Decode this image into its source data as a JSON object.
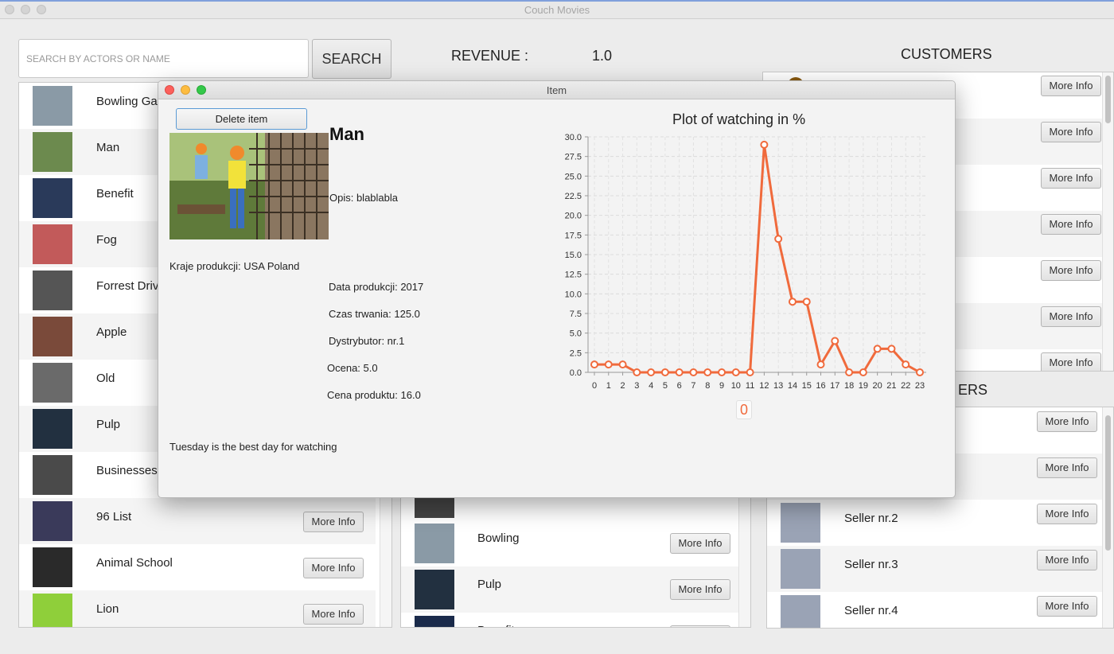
{
  "window": {
    "title": "Couch Movies"
  },
  "search": {
    "placeholder": "SEARCH BY ACTORS OR NAME",
    "button_label": "SEARCH"
  },
  "revenue": {
    "label": "REVENUE :",
    "value": "1.0"
  },
  "customers": {
    "title": "CUSTOMERS",
    "button_label": "More Info",
    "count_visible": 7
  },
  "sellers": {
    "title_fragment": "ERS",
    "button_label": "More Info",
    "items": [
      "",
      "",
      "Seller nr.2",
      "Seller nr.3",
      "Seller nr.4"
    ]
  },
  "movies": {
    "button_label": "More Info",
    "items": [
      "Bowling Ga",
      "Man",
      "Benefit",
      "Fog",
      "Forrest Driv",
      "Apple",
      "Old",
      "Pulp",
      "Businesses",
      "96 List",
      "Animal School",
      "Lion"
    ]
  },
  "middle_list": {
    "button_label": "More Info",
    "items": [
      "Bowling",
      "Pulp",
      "Benefit"
    ]
  },
  "dialog": {
    "title": "Item",
    "delete_label": "Delete item",
    "movie_title": "Man",
    "opis": "Opis: blablabla",
    "kraje": "Kraje produkcji: USA Poland",
    "data_produkcji": "Data produkcji: 2017",
    "czas": "Czas trwania: 125.0",
    "dystrybutor": "Dystrybutor: nr.1",
    "ocena": "Ocena: 5.0",
    "cena": "Cena produktu: 16.0",
    "best_day": "Tuesday is the best day for watching",
    "zero_value": "0"
  },
  "chart_data": {
    "type": "line",
    "title": "Plot of watching in %",
    "x": [
      0,
      1,
      2,
      3,
      4,
      5,
      6,
      7,
      8,
      9,
      10,
      11,
      12,
      13,
      14,
      15,
      16,
      17,
      18,
      19,
      20,
      21,
      22,
      23
    ],
    "series": [
      {
        "values": [
          1,
          1,
          1,
          0,
          0,
          0,
          0,
          0,
          0,
          0,
          0,
          0,
          29,
          17,
          9,
          9,
          1,
          4,
          0,
          0,
          3,
          3,
          1,
          0
        ]
      }
    ],
    "xlabel": "",
    "ylabel": "",
    "ylim": [
      0,
      30
    ],
    "yticks": [
      "0.0",
      "2.5",
      "5.0",
      "7.5",
      "10.0",
      "12.5",
      "15.0",
      "17.5",
      "20.0",
      "22.5",
      "25.0",
      "27.5",
      "30.0"
    ],
    "grid": true,
    "color": "#f06a3c"
  },
  "colors": {
    "accent": "#f06a3c",
    "focus": "#5b9bd5"
  }
}
